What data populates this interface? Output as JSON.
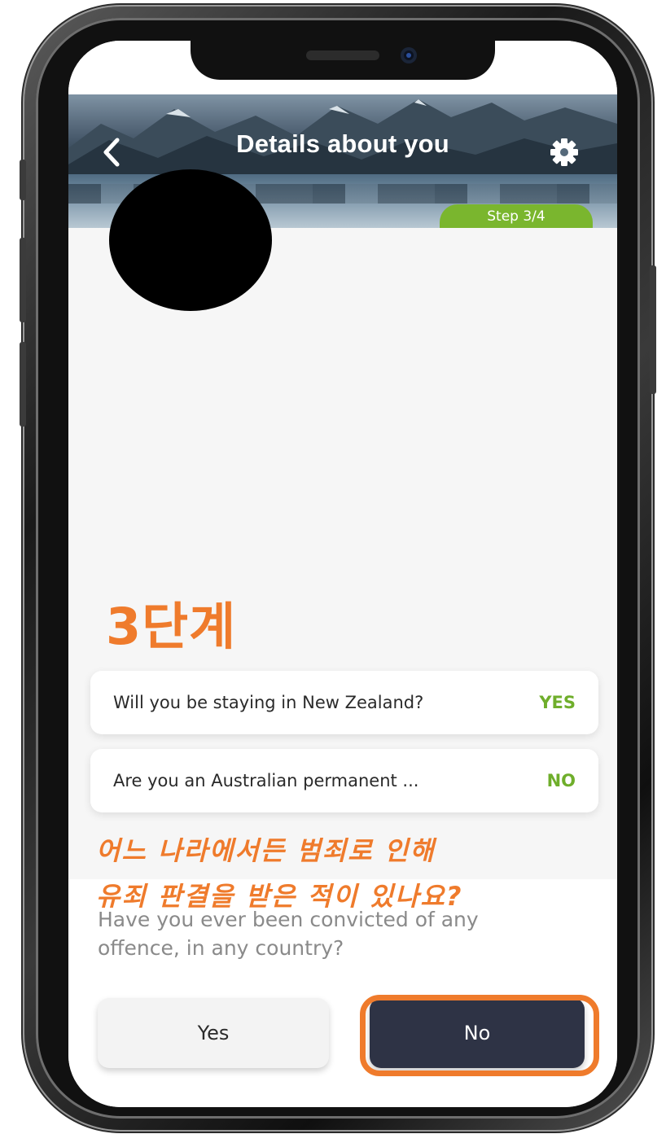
{
  "header": {
    "title": "Details about you",
    "step_label": "Step 3/4"
  },
  "annotation": {
    "step_heading": "3단계",
    "korean_question_line1": "어느 나라에서든 범죄로 인해",
    "korean_question_line2": "유죄 판결을 받은 적이 있나요?",
    "highlight_color": "#ef7b2c"
  },
  "answers": [
    {
      "question": "Will you be staying in New Zealand?",
      "answer": "YES"
    },
    {
      "question": "Are you an Australian permanent ...",
      "answer": "NO"
    }
  ],
  "question": {
    "text_line1": "Have you ever been convicted of any",
    "text_line2": "offence, in any country?"
  },
  "buttons": {
    "yes_label": "Yes",
    "no_label": "No"
  },
  "colors": {
    "accent_green": "#7ab62e",
    "answer_green": "#6fae2b",
    "dark_button": "#2e3345"
  },
  "icons": {
    "back": "chevron-left-icon",
    "settings": "gear-icon"
  }
}
